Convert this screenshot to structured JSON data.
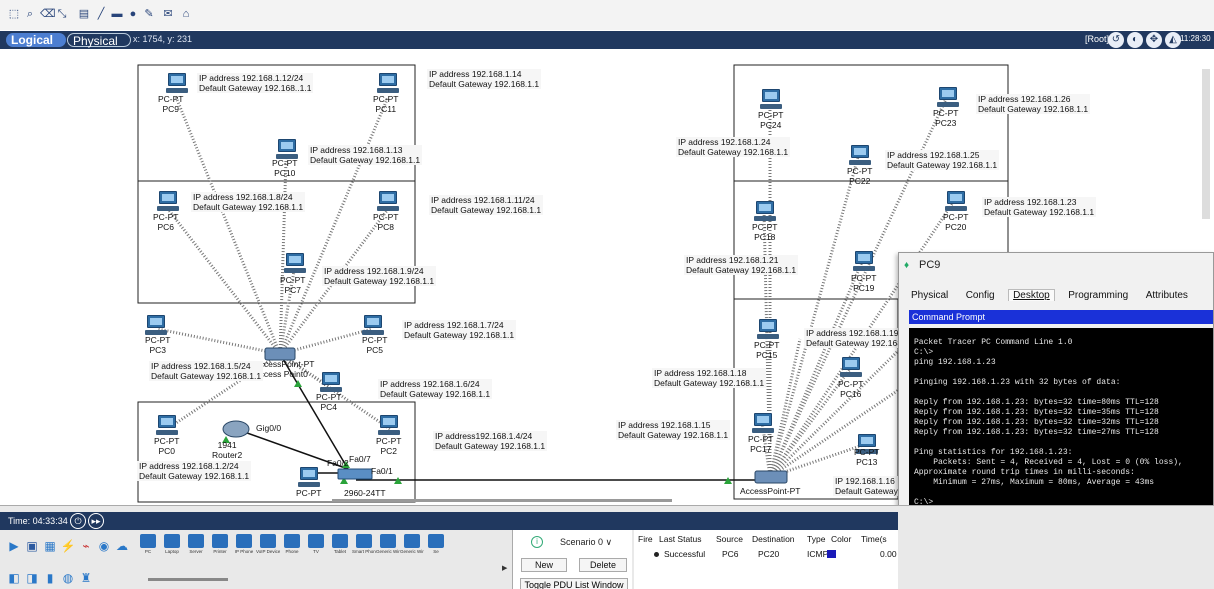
{
  "toolbar": {
    "icons": [
      "select-icon",
      "zoom-icon",
      "delete-icon",
      "resize-icon",
      "note-icon",
      "line-icon",
      "rectangle-icon",
      "ellipse-icon",
      "freeform-icon",
      "simple-pdu-icon",
      "complex-pdu-icon"
    ]
  },
  "modebar": {
    "logical": "Logical",
    "physical": "Physical",
    "coords": "x: 1754, y: 231",
    "root": "[Root]",
    "clock": "11:28:30"
  },
  "devices": {
    "pc0": "PC-PT\nPC0",
    "pc2": "PC-PT\nPC2",
    "pc3": "PC-PT\nPC3",
    "pc4": "PC-PT\nPC4",
    "pc5": "PC-PT\nPC5",
    "pc6": "PC-PT\nPC6",
    "pc7": "PC-PT\nPC7",
    "pc8": "PC-PT\nPC8",
    "pc9": "PC-PT\nPC9",
    "pc10": "PC-PT\nPC10",
    "pc11": "PC-PT\nPC11",
    "pc12": "PC-PT",
    "pc13": "PC-PT\nPC13",
    "pc15": "PC-PT\nPC15",
    "pc16": "PC-PT\nPC16",
    "pc17": "PC-PT\nPC17",
    "pc18": "PC-PT\nPC18",
    "pc19": "PC-PT\nPC19",
    "pc20": "PC-PT\nPC20",
    "pc22": "PC-PT\nPC22",
    "pc23": "PC-PT\nPC23",
    "pc24": "PC-PT\nPC24",
    "router": "1941\nRouter2",
    "switch": "2960-24TT",
    "ap_left": "AccessPoint-PT\nAccess Point0",
    "ap_right": "AccessPoint-PT"
  },
  "ports": {
    "gig00": "Gig0/0",
    "fa02": "Fa0/2",
    "fa07": "Fa0/7",
    "fa01": "Fa0/1"
  },
  "ip_labels": {
    "pc9": "IP address 192.168.1.12/24\nDefault Gateway 192.168..1.1",
    "pc11": "IP address 192.168.1.14\nDefault Gateway 192.168.1.1",
    "pc10": "IP address 192.168.1.13\nDefault Gateway 192.168.1.1",
    "pc6": "IP address 192.168.1.8/24\nDefault Gateway 192.168.1.1",
    "pc8": "IP address 192.168.1.11/24\nDefault Gateway 192.168.1.1",
    "pc7": "IP address 192.168.1.9/24\nDefault Gateway 192.168.1.1",
    "pc5": "IP address 192.168.1.7/24\nDefault Gateway 192.168.1.1",
    "pc3": "IP address 192.168.1.5/24\nDefault Gateway 192.168.1.1",
    "pc4": "IP address 192.168.1.6/24\nDefault Gateway 192.168.1.1",
    "pc2": "IP address192.168.1.4/24\nDefault Gateway 192.168.1.1",
    "pc0": "IP address 192.168.1.2/24\nDefault Gateway 192.168.1.1",
    "pc26": "IP address 192.168.1.26\nDefault Gateway 192.168.1.1",
    "pc24": "IP address 192.168.1.24\nDefault Gateway 192.168.1.1",
    "pc25": "IP address 192.168.1.25\nDefault Gateway 192.168.1.1",
    "pc23b": "IP address 192.168.1.23\nDefault Gateway 192.168.1.1",
    "pc21": "IP address 192.168.1.21\nDefault Gateway 192.168.1.1",
    "pc19": "IP address 192.168.1.19\nDefault Gateway 192.168.1",
    "pc18": "IP address 192.168.1.18\nDefault Gateway 192.168.1.1",
    "pc15": "IP address 192.168.1.15\nDefault Gateway 192.168.1.1",
    "pc16": "IP 192.168.1.16\nDefault Gateway"
  },
  "pc9_window": {
    "title": "PC9",
    "tabs": [
      "Physical",
      "Config",
      "Desktop",
      "Programming",
      "Attributes"
    ],
    "active_tab": "Desktop",
    "cmd_title": "Command Prompt",
    "console": "Packet Tracer PC Command Line 1.0\nC:\\>\nping 192.168.1.23\n\nPinging 192.168.1.23 with 32 bytes of data:\n\nReply from 192.168.1.23: bytes=32 time=80ms TTL=128\nReply from 192.168.1.23: bytes=32 time=35ms TTL=128\nReply from 192.168.1.23: bytes=32 time=32ms TTL=128\nReply from 192.168.1.23: bytes=32 time=27ms TTL=128\n\nPing statistics for 192.168.1.23:\n    Packets: Sent = 4, Received = 4, Lost = 0 (0% loss),\nApproximate round trip times in milli-seconds:\n    Minimum = 27ms, Maximum = 80ms, Average = 43ms\n\nC:\\>"
  },
  "bottom": {
    "time": "Time: 04:33:34",
    "device_types": [
      "PC",
      "Laptop",
      "Server",
      "Printer",
      "IP Phone",
      "VoIP Device",
      "Phone",
      "TV",
      "Tablet",
      "Smart Phone",
      "Generic Wireless",
      "Generic Wired",
      "Se"
    ],
    "scenario": "Scenario 0",
    "new_btn": "New",
    "delete_btn": "Delete",
    "toggle_pdu": "Toggle PDU List Window",
    "pdu_headers": [
      "Fire",
      "Last Status",
      "Source",
      "Destination",
      "Type",
      "Color",
      "Time(s"
    ],
    "pdu_row": {
      "status": "Successful",
      "source": "PC6",
      "destination": "PC20",
      "type": "ICMP",
      "time": "0.00"
    }
  }
}
